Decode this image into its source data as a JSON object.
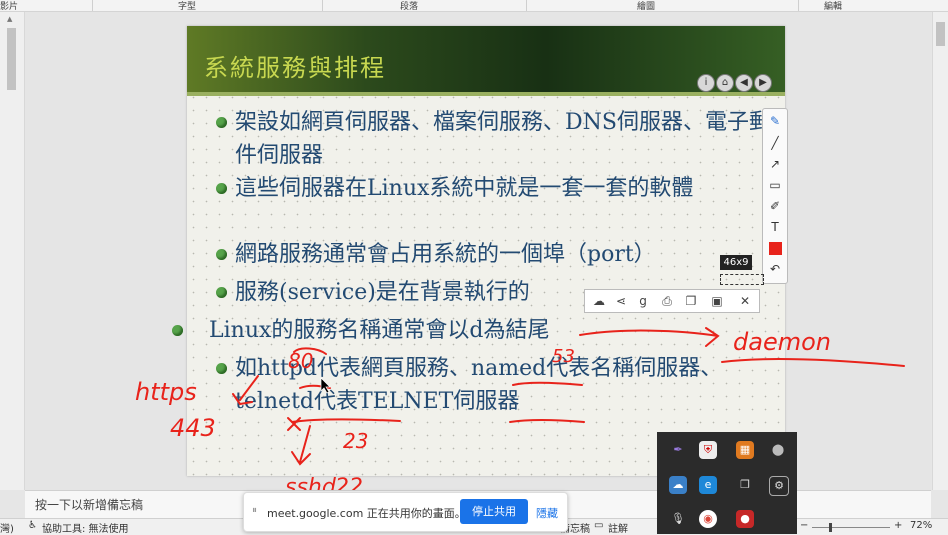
{
  "ribbon": {
    "groups": [
      "影片",
      "字型",
      "段落",
      "繪圖",
      "編輯"
    ]
  },
  "slide": {
    "title": "系統服務與排程",
    "bullets": [
      "架設如網頁伺服器、檔案伺服務、DNS伺服器、電子郵件伺服器",
      "這些伺服器在Linux系統中就是一套一套的軟體",
      "網路服務通常會占用系統的一個埠（port）",
      "服務(service)是在背景執行的",
      "Linux的服務名稱通常會以d為結尾",
      "如httpd代表網頁服務、named代表名稱伺服器、telnetd代表TELNET伺服器"
    ],
    "nav_buttons": [
      "i",
      "⌂",
      "◀",
      "▶"
    ]
  },
  "handwriting": {
    "http_port": "80",
    "https_label": "https",
    "https_port": "443",
    "named_port": "53",
    "daemon": "daemon",
    "telnet_port": "23",
    "sshd": "sshd",
    "sshd_port": "22"
  },
  "selection": {
    "size_label": "46x9"
  },
  "notes": {
    "placeholder": "按一下以新增備忘稿"
  },
  "statusbar": {
    "left": "灣)",
    "accessibility": "協助工具: 無法使用",
    "notes_label": "備忘稿",
    "comments_label": "註解",
    "zoom_minus": "−",
    "zoom_plus": "+",
    "zoom": "72%"
  },
  "meet": {
    "message": "meet.google.com 正在共用你的畫面。",
    "stop_label": "停止共用",
    "hide_label": "隱藏"
  },
  "colors": {
    "ink": "#e8231b",
    "bullet_text": "#234a72",
    "title_text": "#c8d850",
    "meet_button": "#1a73e8"
  }
}
